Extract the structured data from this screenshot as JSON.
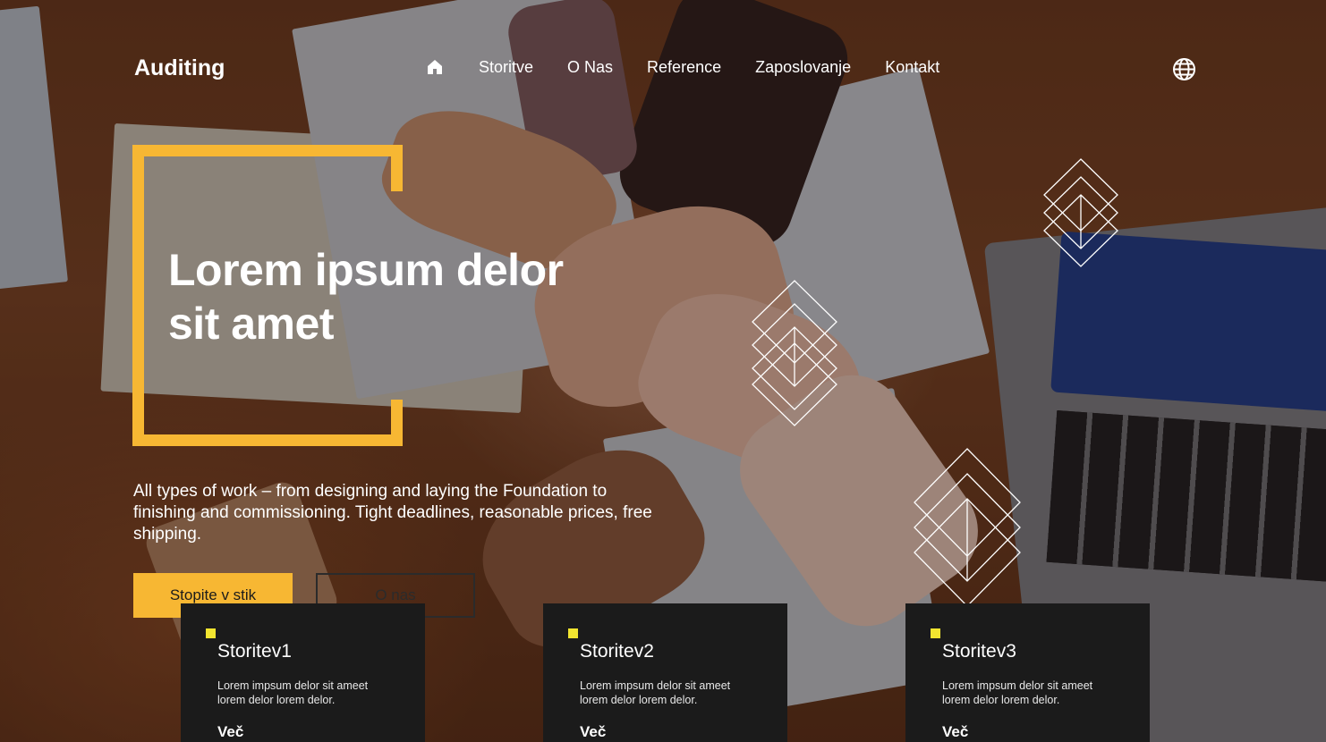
{
  "header": {
    "logo": "Auditing",
    "nav": [
      {
        "label": "Storitve"
      },
      {
        "label": "O Nas"
      },
      {
        "label": "Reference"
      },
      {
        "label": "Zaposlovanje"
      },
      {
        "label": "Kontakt"
      }
    ],
    "home_icon": "home-icon",
    "language_icon": "globe-icon"
  },
  "hero": {
    "title_line1": "Lorem ipsum delor",
    "title_line2": "sit amet",
    "subtitle": "All types of work – from designing and laying the Foundation to finishing and commissioning. Tight deadlines, reasonable prices, free shipping.",
    "primary_button": "Stopite v stik",
    "secondary_button": "O nas"
  },
  "services": [
    {
      "title": "Storitev1",
      "desc": "Lorem impsum delor sit ameet lorem delor lorem delor.",
      "more": "Več"
    },
    {
      "title": "Storitev2",
      "desc": "Lorem impsum delor sit ameet lorem delor lorem delor.",
      "more": "Več"
    },
    {
      "title": "Storitev3",
      "desc": "Lorem impsum delor sit ameet lorem delor lorem delor.",
      "more": "Več"
    }
  ],
  "colors": {
    "accent": "#f7b733",
    "card_bg": "#1b1b1b",
    "card_marker": "#f2e530",
    "text_light": "#ffffff"
  }
}
